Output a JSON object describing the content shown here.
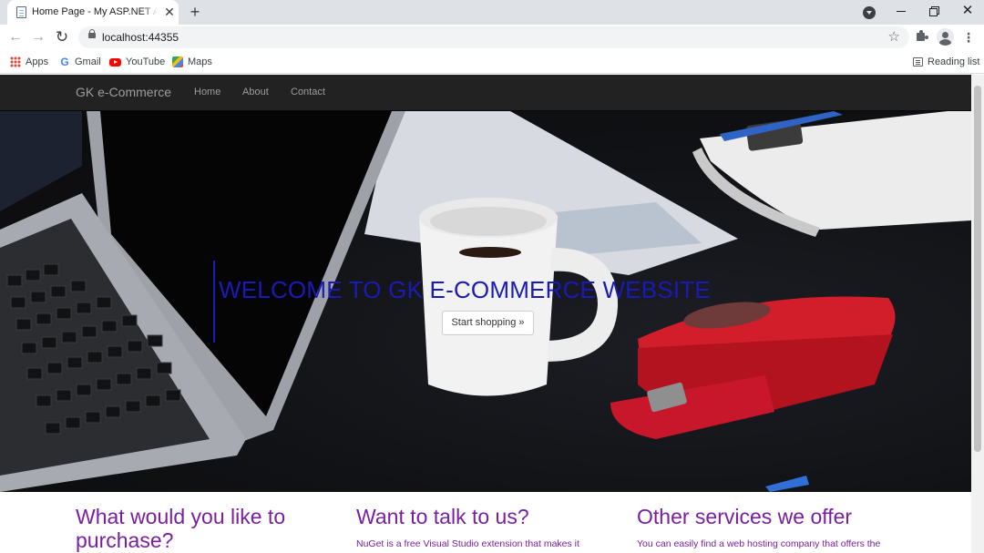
{
  "browser": {
    "tab_title": "Home Page - My ASP.NET Application",
    "new_tab_label": "+",
    "close_tab_label": "✕",
    "url": "localhost:44355",
    "bookmarks": [
      {
        "label": "Apps",
        "icon": "apps-icon"
      },
      {
        "label": "Gmail",
        "icon": "gmail-icon"
      },
      {
        "label": "YouTube",
        "icon": "youtube-icon"
      },
      {
        "label": "Maps",
        "icon": "maps-icon"
      }
    ],
    "reading_list_label": "Reading list"
  },
  "site": {
    "brand": "GK e-Commerce",
    "nav": [
      {
        "label": "Home"
      },
      {
        "label": "About"
      },
      {
        "label": "Contact"
      }
    ],
    "hero": {
      "title": "WELCOME TO GK E-COMMERCE WEBSITE",
      "button_label": "Start shopping »"
    },
    "columns": [
      {
        "heading": "What would you like to purchase?",
        "text": ""
      },
      {
        "heading": "Want to talk to us?",
        "text": "NuGet is a free Visual Studio extension that makes it"
      },
      {
        "heading": "Other services we offer",
        "text": "You can easily find a web hosting company that offers the"
      }
    ]
  },
  "colors": {
    "navbar_bg": "#222222",
    "nav_text": "#9d9d9d",
    "hero_title": "#1a1ab8",
    "heading_purple": "#7a1fa2"
  }
}
